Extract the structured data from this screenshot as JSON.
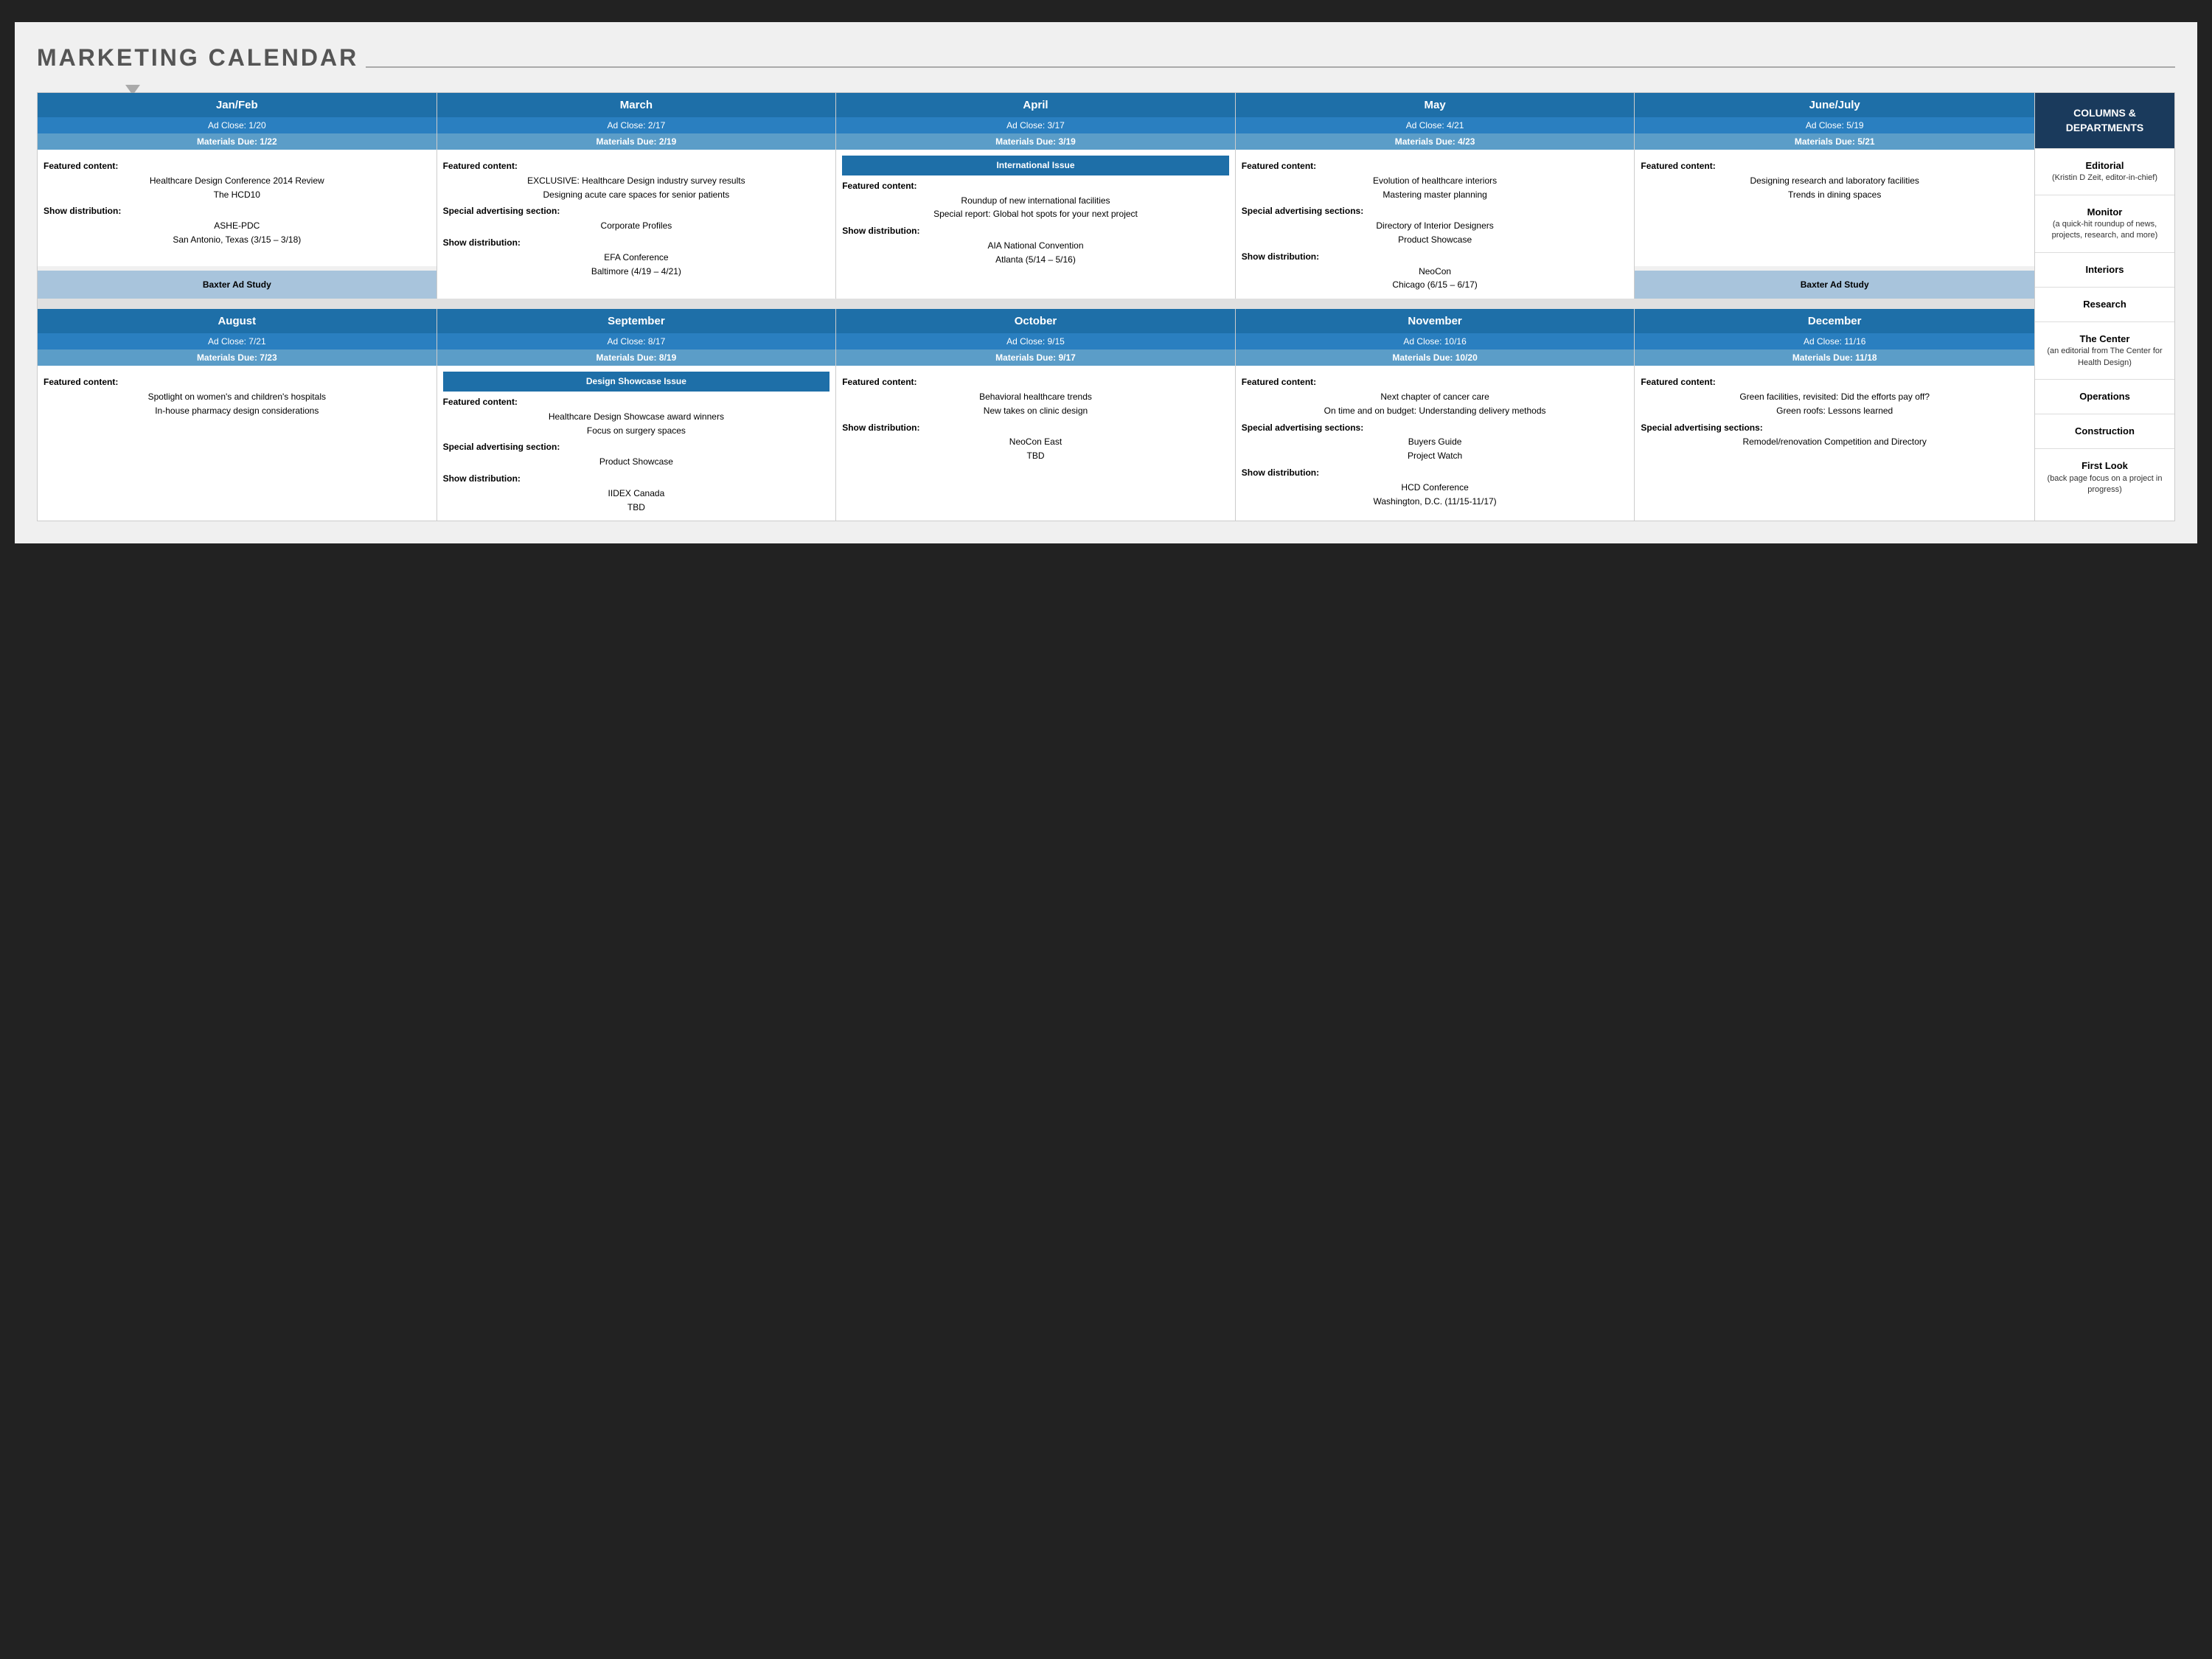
{
  "title": "MARKETING CALENDAR",
  "months_row1": [
    {
      "name": "Jan/Feb",
      "ad_close": "Ad Close: 1/20",
      "materials_due": "Materials Due: 1/22",
      "featured_label": "Featured content:",
      "featured_items": [
        "Healthcare Design Conference 2014 Review",
        "The HCD10"
      ],
      "show_dist_label": "Show distribution:",
      "show_dist_items": [
        "ASHE-PDC",
        "San Antonio, Texas (3/15 – 3/18)"
      ],
      "extra_box": "Baxter Ad Study",
      "special_ad": null,
      "special_ad_items": [],
      "intl_issue": null,
      "design_showcase": null
    },
    {
      "name": "March",
      "ad_close": "Ad Close: 2/17",
      "materials_due": "Materials Due: 2/19",
      "featured_label": "Featured content:",
      "featured_items": [
        "EXCLUSIVE: Healthcare Design industry survey results",
        "Designing acute care spaces for senior patients"
      ],
      "special_ad_label": "Special advertising section:",
      "special_ad_items": [
        "Corporate Profiles"
      ],
      "show_dist_label": "Show distribution:",
      "show_dist_items": [
        "EFA Conference",
        "Baltimore (4/19 – 4/21)"
      ],
      "extra_box": null,
      "intl_issue": null,
      "design_showcase": null
    },
    {
      "name": "April",
      "ad_close": "Ad Close: 3/17",
      "materials_due": "Materials Due: 3/19",
      "intl_issue": "International Issue",
      "featured_label": "Featured content:",
      "featured_items": [
        "Roundup of new international facilities",
        "Special report: Global hot spots for your next project"
      ],
      "show_dist_label": "Show distribution:",
      "show_dist_items": [
        "AIA National Convention",
        "Atlanta (5/14 – 5/16)"
      ],
      "extra_box": null,
      "special_ad": null,
      "special_ad_items": [],
      "design_showcase": null
    },
    {
      "name": "May",
      "ad_close": "Ad Close: 4/21",
      "materials_due": "Materials Due: 4/23",
      "featured_label": "Featured content:",
      "featured_items": [
        "Evolution of healthcare interiors",
        "Mastering master planning"
      ],
      "special_ad_label": "Special advertising sections:",
      "special_ad_items": [
        "Directory of Interior Designers",
        "Product Showcase"
      ],
      "show_dist_label": "Show distribution:",
      "show_dist_items": [
        "NeoCon",
        "Chicago (6/15 – 6/17)"
      ],
      "extra_box": null,
      "intl_issue": null,
      "design_showcase": null
    },
    {
      "name": "June/July",
      "ad_close": "Ad Close: 5/19",
      "materials_due": "Materials Due: 5/21",
      "featured_label": "Featured content:",
      "featured_items": [
        "Designing research and laboratory facilities",
        "Trends in dining spaces"
      ],
      "extra_box": "Baxter Ad Study",
      "special_ad": null,
      "special_ad_items": [],
      "show_dist_label": null,
      "show_dist_items": [],
      "intl_issue": null,
      "design_showcase": null
    }
  ],
  "months_row2": [
    {
      "name": "August",
      "ad_close": "Ad Close: 7/21",
      "materials_due": "Materials Due: 7/23",
      "featured_label": "Featured content:",
      "featured_items": [
        "Spotlight on women's and children's hospitals",
        "In-house pharmacy design considerations"
      ],
      "show_dist_label": null,
      "show_dist_items": [],
      "extra_box": null,
      "special_ad": null,
      "special_ad_items": [],
      "intl_issue": null,
      "design_showcase": null
    },
    {
      "name": "September",
      "ad_close": "Ad Close: 8/17",
      "materials_due": "Materials Due: 8/19",
      "design_showcase": "Design Showcase Issue",
      "featured_label": "Featured content:",
      "featured_items": [
        "Healthcare Design Showcase award winners",
        "Focus on surgery spaces"
      ],
      "special_ad_label": "Special advertising section:",
      "special_ad_items": [
        "Product Showcase"
      ],
      "show_dist_label": "Show distribution:",
      "show_dist_items": [
        "IIDEX Canada",
        "TBD"
      ],
      "extra_box": null,
      "intl_issue": null
    },
    {
      "name": "October",
      "ad_close": "Ad Close: 9/15",
      "materials_due": "Materials Due: 9/17",
      "featured_label": "Featured content:",
      "featured_items": [
        "Behavioral healthcare trends",
        "New takes on clinic design"
      ],
      "show_dist_label": "Show distribution:",
      "show_dist_items": [
        "NeoCon East",
        "TBD"
      ],
      "extra_box": null,
      "special_ad": null,
      "special_ad_items": [],
      "intl_issue": null,
      "design_showcase": null
    },
    {
      "name": "November",
      "ad_close": "Ad Close: 10/16",
      "materials_due": "Materials Due: 10/20",
      "featured_label": "Featured content:",
      "featured_items": [
        "Next chapter of cancer care",
        "On time and on budget: Understanding delivery methods"
      ],
      "special_ad_label": "Special advertising sections:",
      "special_ad_items": [
        "Buyers Guide",
        "Project Watch"
      ],
      "show_dist_label": "Show distribution:",
      "show_dist_items": [
        "HCD Conference",
        "Washington, D.C. (11/15-11/17)"
      ],
      "extra_box": null,
      "intl_issue": null,
      "design_showcase": null
    },
    {
      "name": "December",
      "ad_close": "Ad Close: 11/16",
      "materials_due": "Materials Due: 11/18",
      "featured_label": "Featured content:",
      "featured_items": [
        "Green facilities, revisited: Did the efforts pay off?",
        "Green roofs: Lessons learned"
      ],
      "special_ad_label": "Special advertising sections:",
      "special_ad_items": [
        "Remodel/renovation Competition and Directory"
      ],
      "show_dist_label": null,
      "show_dist_items": [],
      "extra_box": null,
      "intl_issue": null,
      "design_showcase": null
    }
  ],
  "sidebar": {
    "header": "COLUMNS &\nDEPARTMENTS",
    "items": [
      {
        "title": "Editorial",
        "sub": "(Kristin D Zeit, editor-in-chief)"
      },
      {
        "title": "Monitor",
        "sub": "(a quick-hit roundup of news, projects, research, and more)"
      },
      {
        "title": "Interiors",
        "sub": ""
      },
      {
        "title": "Research",
        "sub": ""
      },
      {
        "title": "The Center",
        "sub": "(an editorial from The Center for Health Design)"
      },
      {
        "title": "Operations",
        "sub": ""
      },
      {
        "title": "Construction",
        "sub": ""
      },
      {
        "title": "First Look",
        "sub": "(back page focus on a project in progress)"
      }
    ]
  }
}
